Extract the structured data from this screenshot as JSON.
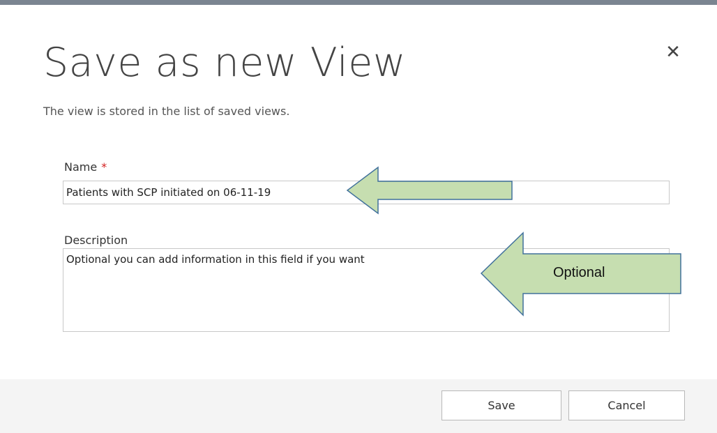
{
  "dialog": {
    "title": "Save as new View",
    "subtitle": "The view is stored in the list of saved views.",
    "close_icon": "close-icon"
  },
  "form": {
    "name_label": "Name",
    "required_marker": "*",
    "name_value": "Patients with SCP initiated on 06-11-19",
    "description_label": "Description",
    "description_value": "Optional you can add information in this field if you want"
  },
  "annotations": {
    "optional_label": "Optional",
    "arrow_fill": "#c6deb0",
    "arrow_stroke": "#41719c"
  },
  "footer": {
    "save_label": "Save",
    "cancel_label": "Cancel"
  }
}
